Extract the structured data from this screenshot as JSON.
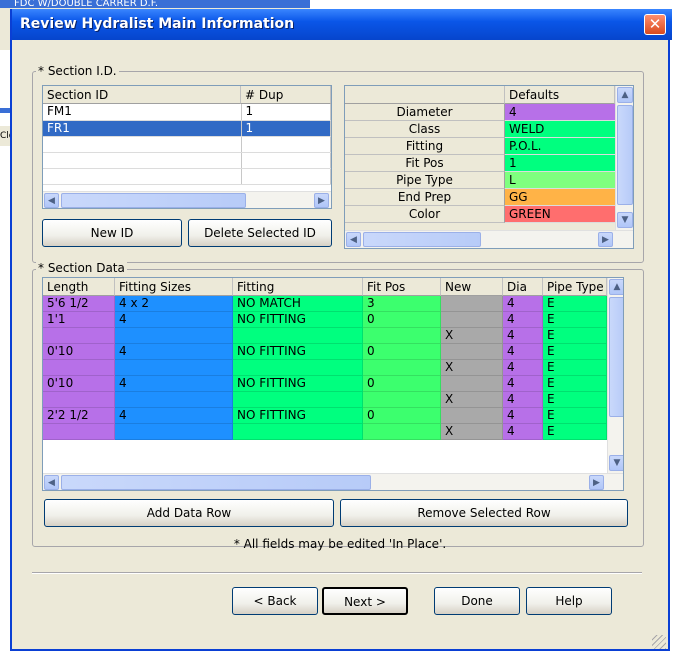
{
  "background": {
    "row_text": "FDC W/DOUBLE CARRER D.F.",
    "side_label": "Clo"
  },
  "window": {
    "title": "Review Hydralist Main Information",
    "close_glyph": "✕"
  },
  "section_id": {
    "group_title": "* Section I.D.",
    "columns": [
      "Section ID",
      "# Dup"
    ],
    "rows": [
      {
        "id": "FM1",
        "dup": "1"
      },
      {
        "id": "FR1",
        "dup": "1"
      }
    ],
    "new_id_button": "New ID",
    "delete_button": "Delete Selected ID"
  },
  "defaults": {
    "header": "Defaults",
    "rows": [
      {
        "label": "Diameter",
        "value": "4",
        "color": "#b770e8"
      },
      {
        "label": "Class",
        "value": "WELD",
        "color": "#00ff7f"
      },
      {
        "label": "Fitting",
        "value": "P.O.L.",
        "color": "#00ff7f"
      },
      {
        "label": "Fit Pos",
        "value": "1",
        "color": "#00ff7f"
      },
      {
        "label": "Pipe Type",
        "value": "L",
        "color": "#7fff7f"
      },
      {
        "label": "End Prep",
        "value": "GG",
        "color": "#ffb347"
      },
      {
        "label": "Color",
        "value": "GREEN",
        "color": "#ff6e6e"
      }
    ]
  },
  "section_data": {
    "group_title": "* Section Data",
    "columns": [
      "Length",
      "Fitting Sizes",
      "Fitting",
      "Fit Pos",
      "New",
      "Dia",
      "Pipe Type"
    ],
    "rows": [
      [
        "5'6 1/2",
        "4 x 2",
        "NO MATCH",
        "3",
        "",
        "4",
        "E"
      ],
      [
        "1'1",
        "4",
        "NO FITTING",
        "0",
        "",
        "4",
        "E"
      ],
      [
        "",
        "",
        "",
        "",
        "X",
        "4",
        "E"
      ],
      [
        "0'10",
        "4",
        "NO FITTING",
        "0",
        "",
        "4",
        "E"
      ],
      [
        "",
        "",
        "",
        "",
        "X",
        "4",
        "E"
      ],
      [
        "0'10",
        "4",
        "NO FITTING",
        "0",
        "",
        "4",
        "E"
      ],
      [
        "",
        "",
        "",
        "",
        "X",
        "4",
        "E"
      ],
      [
        "2'2 1/2",
        "4",
        "NO FITTING",
        "0",
        "",
        "4",
        "E"
      ],
      [
        "",
        "",
        "",
        "",
        "X",
        "4",
        "E"
      ]
    ],
    "add_button": "Add Data Row",
    "remove_button": "Remove Selected Row",
    "note": "* All fields may be edited 'In Place'."
  },
  "footer": {
    "back": "< Back",
    "next": "Next >",
    "done": "Done",
    "help": "Help"
  },
  "colors": {
    "length": "#b770e8",
    "sizes": "#1e90ff",
    "fitting": "#00ff7f",
    "fitpos": "#3cff6e",
    "new": "#a9a9a9",
    "dia": "#b770e8",
    "pipetype": "#00ff7f"
  }
}
